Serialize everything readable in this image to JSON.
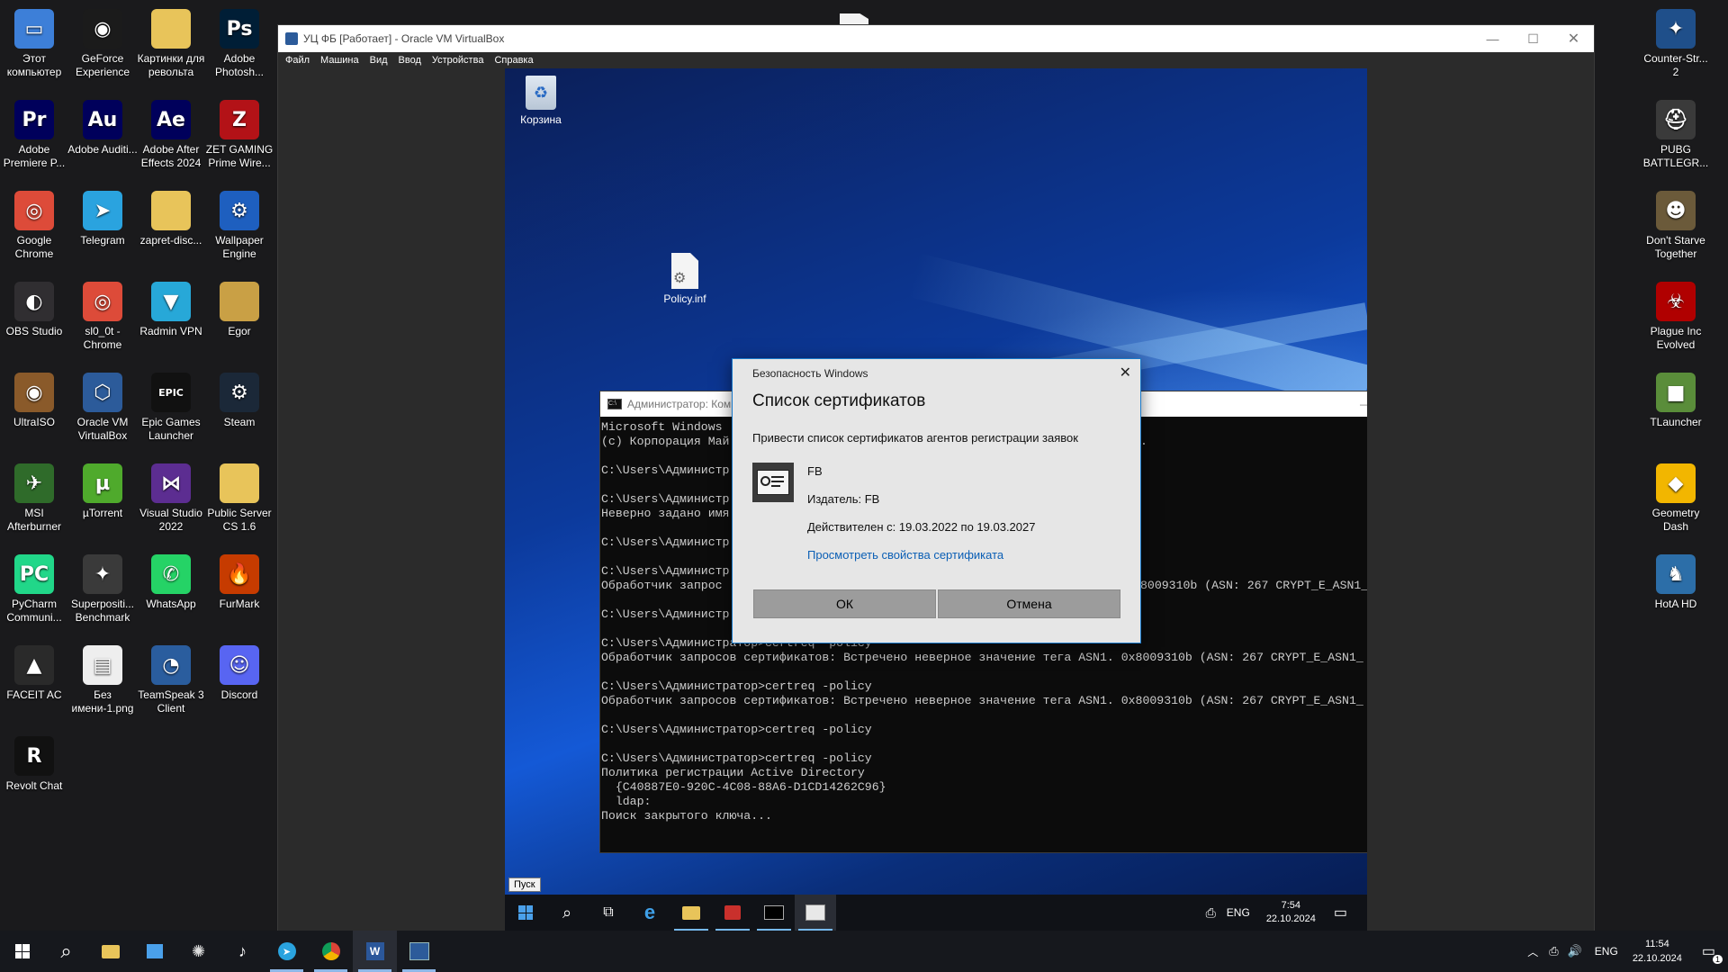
{
  "host": {
    "desktop_icons_left": [
      {
        "label": "Этот компьютер",
        "icon": "pc-icon",
        "color": "#3d7fd8",
        "glyph": "▭"
      },
      {
        "label": "GeForce Experience",
        "icon": "nvidia-icon",
        "color": "#1b1b1b",
        "glyph": "◉"
      },
      {
        "label": "Картинки для револьта",
        "icon": "folder-icon",
        "color": "#e8c45a",
        "glyph": ""
      },
      {
        "label": "Adobe Photosh...",
        "icon": "photoshop-icon",
        "color": "#001e36",
        "glyph": "Ps"
      },
      {
        "label": "Adobe Premiere P...",
        "icon": "premiere-icon",
        "color": "#00005b",
        "glyph": "Pr"
      },
      {
        "label": "Adobe Auditi...",
        "icon": "audition-icon",
        "color": "#00005b",
        "glyph": "Au"
      },
      {
        "label": "Adobe After Effects 2024",
        "icon": "after-effects-icon",
        "color": "#00005b",
        "glyph": "Ae"
      },
      {
        "label": "ZET GAMING Prime Wire...",
        "icon": "zet-gaming-icon",
        "color": "#b31217",
        "glyph": "Z"
      },
      {
        "label": "Google Chrome",
        "icon": "chrome-icon",
        "color": "#dd4b39",
        "glyph": "◎"
      },
      {
        "label": "Telegram",
        "icon": "telegram-icon",
        "color": "#2aa3df",
        "glyph": "➤"
      },
      {
        "label": "zapret-disc...",
        "icon": "folder-icon",
        "color": "#e8c45a",
        "glyph": ""
      },
      {
        "label": "Wallpaper Engine",
        "icon": "wallpaper-engine-icon",
        "color": "#1e5fbf",
        "glyph": "⚙"
      },
      {
        "label": "OBS Studio",
        "icon": "obs-icon",
        "color": "#302e31",
        "glyph": "◐"
      },
      {
        "label": "sl0_0t - Chrome",
        "icon": "chrome-profile-icon",
        "color": "#dd4b39",
        "glyph": "◎"
      },
      {
        "label": "Radmin VPN",
        "icon": "radmin-vpn-icon",
        "color": "#27a8d8",
        "glyph": "▼"
      },
      {
        "label": "Egor",
        "icon": "folder-icon",
        "color": "#c9a045",
        "glyph": ""
      },
      {
        "label": "UltraISO",
        "icon": "ultraiso-icon",
        "color": "#8a5a2a",
        "glyph": "◉"
      },
      {
        "label": "Oracle VM VirtualBox",
        "icon": "virtualbox-icon",
        "color": "#2c5b9a",
        "glyph": "⬡"
      },
      {
        "label": "Epic Games Launcher",
        "icon": "epic-games-icon",
        "color": "#111",
        "glyph": "EPIC"
      },
      {
        "label": "Steam",
        "icon": "steam-icon",
        "color": "#1b2838",
        "glyph": "⚙"
      },
      {
        "label": "MSI Afterburner",
        "icon": "msi-afterburner-icon",
        "color": "#2f6b2a",
        "glyph": "✈"
      },
      {
        "label": "µTorrent",
        "icon": "utorrent-icon",
        "color": "#4faa2c",
        "glyph": "µ"
      },
      {
        "label": "Visual Studio 2022",
        "icon": "visual-studio-icon",
        "color": "#5c2d91",
        "glyph": "⋈"
      },
      {
        "label": "Public Server CS 1.6",
        "icon": "folder-icon",
        "color": "#e8c45a",
        "glyph": ""
      },
      {
        "label": "PyCharm Communi...",
        "icon": "pycharm-icon",
        "color": "#21d789",
        "glyph": "PC"
      },
      {
        "label": "Superpositi... Benchmark",
        "icon": "superposition-icon",
        "color": "#3a3a3a",
        "glyph": "✦"
      },
      {
        "label": "WhatsApp",
        "icon": "whatsapp-icon",
        "color": "#25d366",
        "glyph": "✆"
      },
      {
        "label": "FurMark",
        "icon": "furmark-icon",
        "color": "#c63b00",
        "glyph": "🔥"
      },
      {
        "label": "FACEIT AC",
        "icon": "faceit-icon",
        "color": "#2a2a2a",
        "glyph": "▲"
      },
      {
        "label": "Без имени-1.png",
        "icon": "image-file-icon",
        "color": "#eeeeee",
        "glyph": "▤"
      },
      {
        "label": "TeamSpeak 3 Client",
        "icon": "teamspeak-icon",
        "color": "#2a5d9e",
        "glyph": "◔"
      },
      {
        "label": "Discord",
        "icon": "discord-icon",
        "color": "#5865f2",
        "glyph": "☺"
      },
      {
        "label": "Revolt Chat",
        "icon": "revolt-icon",
        "color": "#111",
        "glyph": "R"
      }
    ],
    "desktop_icons_right": [
      {
        "label": "Counter-Str... 2",
        "icon": "cs2-icon",
        "color": "#1f4f8a",
        "glyph": "✦"
      },
      {
        "label": "PUBG BATTLEGR...",
        "icon": "pubg-icon",
        "color": "#3a3a3a",
        "glyph": "⛑"
      },
      {
        "label": "Don't Starve Together",
        "icon": "dont-starve-icon",
        "color": "#6b5a3a",
        "glyph": "☻"
      },
      {
        "label": "Plague Inc Evolved",
        "icon": "plague-inc-icon",
        "color": "#b00000",
        "glyph": "☣"
      },
      {
        "label": "TLauncher",
        "icon": "tlauncher-icon",
        "color": "#5a8d3a",
        "glyph": "■"
      },
      {
        "label": "Geometry Dash",
        "icon": "geometry-dash-icon",
        "color": "#f2b600",
        "glyph": "◆"
      },
      {
        "label": "HotA HD",
        "icon": "hota-icon",
        "color": "#2c6ea8",
        "glyph": "♞"
      }
    ],
    "taskbar": {
      "time": "11:54",
      "date": "22.10.2024",
      "lang": "ENG",
      "notif_count": "1"
    }
  },
  "vbox": {
    "title": "УЦ ФБ [Работает] - Oracle VM VirtualBox",
    "menu": [
      "Файл",
      "Машина",
      "Вид",
      "Ввод",
      "Устройства",
      "Справка"
    ]
  },
  "guest": {
    "recycle_bin_label": "Корзина",
    "policy_file_label": "Policy.inf",
    "cmd_title": "Администратор: Ком",
    "cmd_lines": [
      "Microsoft Windows",
      "(c) Корпорация Май",
      "",
      "C:\\Users\\Администр",
      "",
      "C:\\Users\\Администр",
      "Неверно задано имя",
      "",
      "C:\\Users\\Администр",
      "",
      "C:\\Users\\Администр",
      "Обработчик запрос",
      "",
      "C:\\Users\\Администр",
      "",
      "C:\\Users\\Администратор>certreq -policy",
      "Обработчик запросов сертификатов: Встречено неверное значение тега ASN1. 0x8009310b (ASN: 267 CRYPT_E_ASN1_",
      "",
      "C:\\Users\\Администратор>certreq -policy",
      "Обработчик запросов сертификатов: Встречено неверное значение тега ASN1. 0x8009310b (ASN: 267 CRYPT_E_ASN1_",
      "",
      "C:\\Users\\Администратор>certreq -policy",
      "",
      "C:\\Users\\Администратор>certreq -policy",
      "Политика регистрации Active Directory",
      "  {C40887E0-920C-4C08-88A6-D1CD14262C96}",
      "  ldap:",
      "Поиск закрытого ключа..."
    ],
    "cmd_right_fragments": [
      {
        "line": 1,
        "text": "."
      },
      {
        "line": 11,
        "text": "8009310b (ASN: 267 CRYPT_E_ASN1_"
      }
    ],
    "dialog": {
      "caption": "Безопасность Windows",
      "heading": "Список сертификатов",
      "instruction": "Привести список сертификатов агентов регистрации заявок",
      "cert_name": "FB",
      "issuer": "Издатель: FB",
      "validity": "Действителен с: 19.03.2022 по 19.03.2027",
      "link": "Просмотреть свойства сертификата",
      "ok": "ОК",
      "cancel": "Отмена"
    },
    "start_tooltip": "Пуск",
    "taskbar": {
      "lang": "ENG",
      "time": "7:54",
      "date": "22.10.2024"
    }
  }
}
